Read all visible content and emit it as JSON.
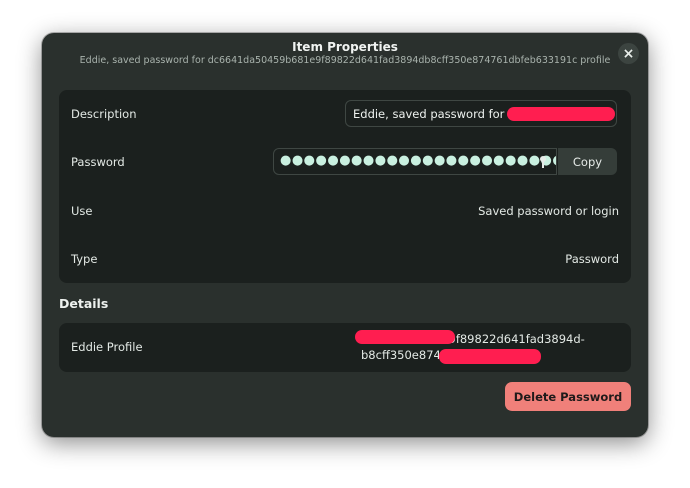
{
  "dialog": {
    "title": "Item Properties",
    "subtitle": "Eddie, saved password for dc6641da50459b681e9f89822d641fad3894db8cff350e874761dbfeb633191c profile",
    "close_icon": "close-icon"
  },
  "fields": {
    "description_label": "Description",
    "description_value": "Eddie, saved password for",
    "password_label": "Password",
    "password_value": "●●●●●●●●●●●●●●●●●●●●●●●●",
    "password_icon": "key-icon",
    "copy_label": "Copy",
    "use_label": "Use",
    "use_value": "Saved password or login",
    "type_label": "Type",
    "type_value": "Password"
  },
  "details": {
    "heading": "Details",
    "profile_label": "Eddie Profile",
    "profile_value_line1": "              b681e9f89822d641fad3894d-",
    "profile_value_line2": "b8cff350e874"
  },
  "actions": {
    "delete_label": "Delete Password"
  },
  "colors": {
    "dialog_bg": "#2a302d",
    "card_bg": "#1b201e",
    "accent_destructive": "#f0807a",
    "redaction": "#ff1e50"
  }
}
